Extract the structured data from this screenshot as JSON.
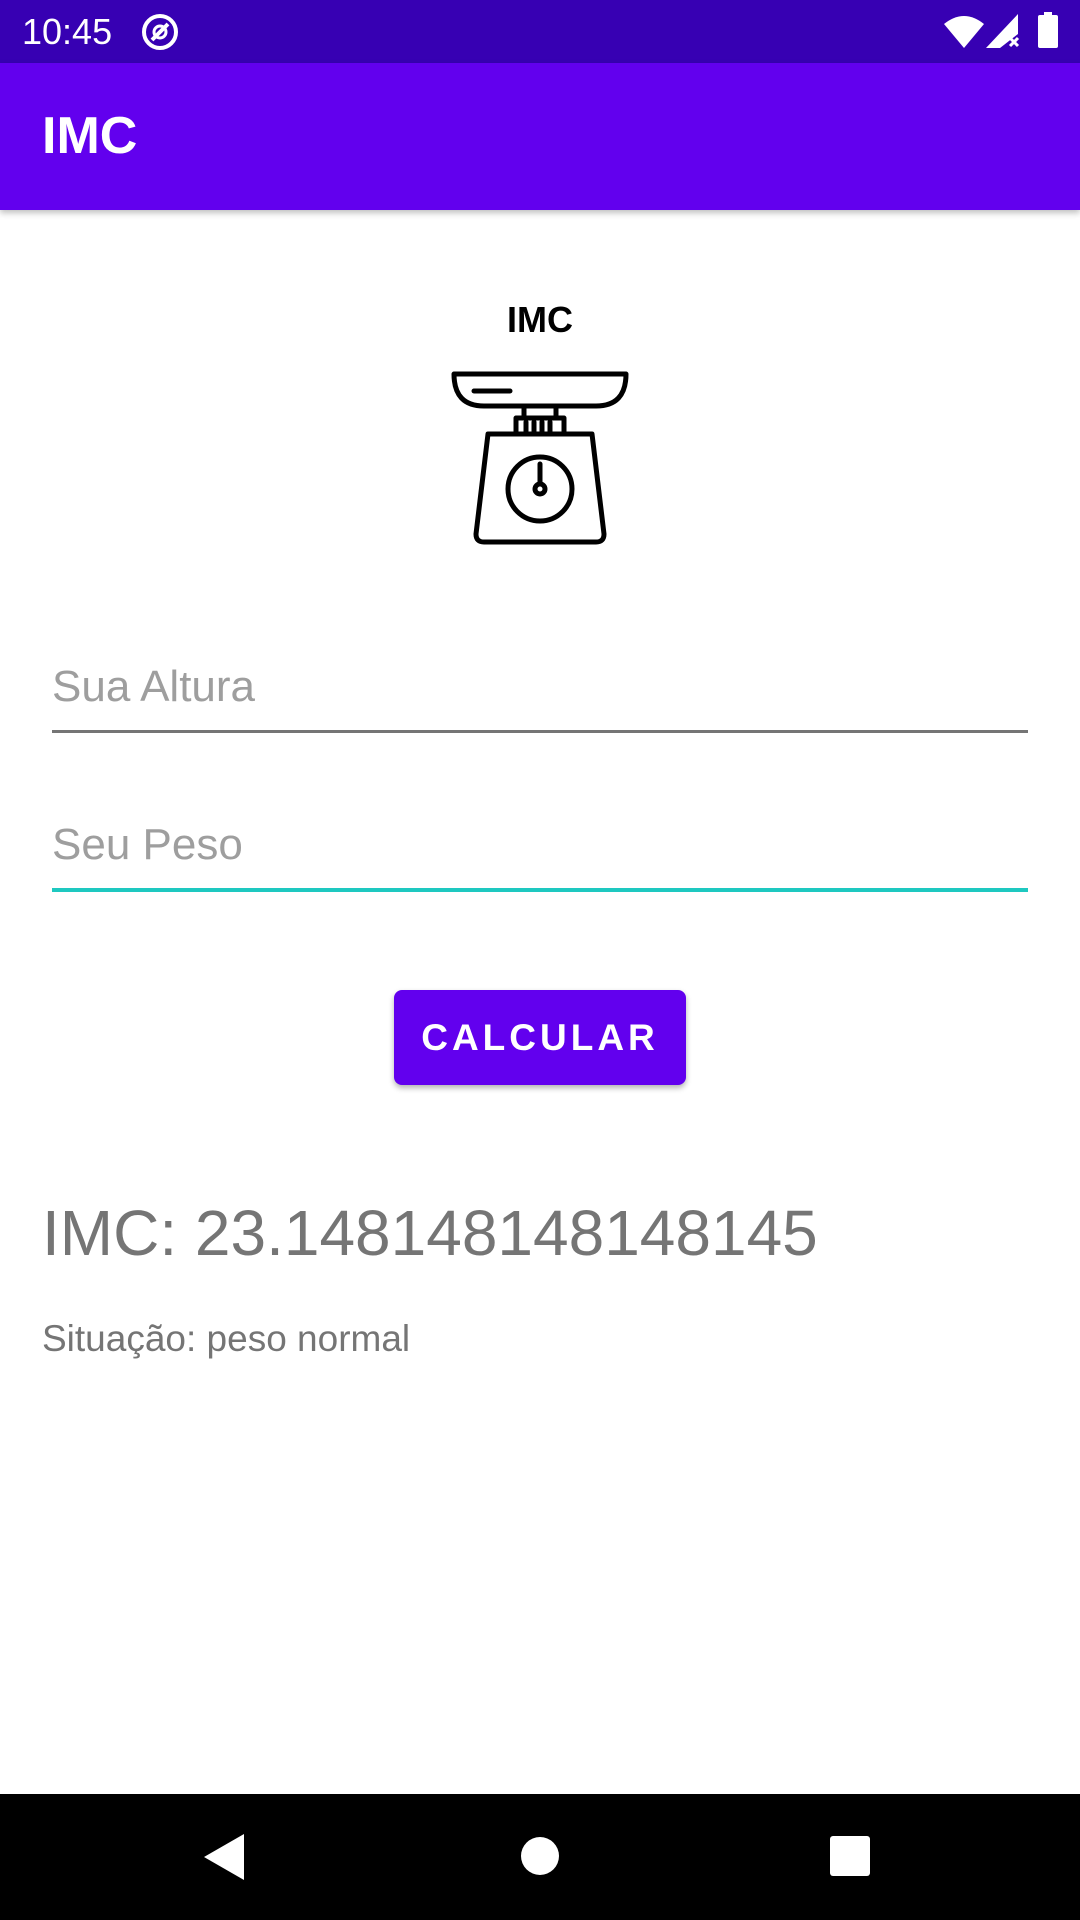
{
  "status_bar": {
    "time": "10:45",
    "icons": [
      "at-sign-icon",
      "wifi-icon",
      "signal-icon",
      "battery-icon"
    ]
  },
  "app_bar": {
    "title": "IMC"
  },
  "header": {
    "title": "IMC",
    "icon": "scale-icon"
  },
  "form": {
    "altura": {
      "placeholder": "Sua Altura",
      "value": ""
    },
    "peso": {
      "placeholder": "Seu Peso",
      "value": ""
    },
    "calculate_label": "CALCULAR"
  },
  "result": {
    "imc_text": "IMC: 23.148148148148145",
    "situacao_text": "Situação: peso normal"
  },
  "nav_bar": {
    "icons": [
      "back-icon",
      "home-icon",
      "recents-icon"
    ]
  },
  "colors": {
    "primary": "#6200ee",
    "primary_dark": "#3700b3",
    "accent": "#1ec8c0",
    "result_text": "#757575"
  }
}
